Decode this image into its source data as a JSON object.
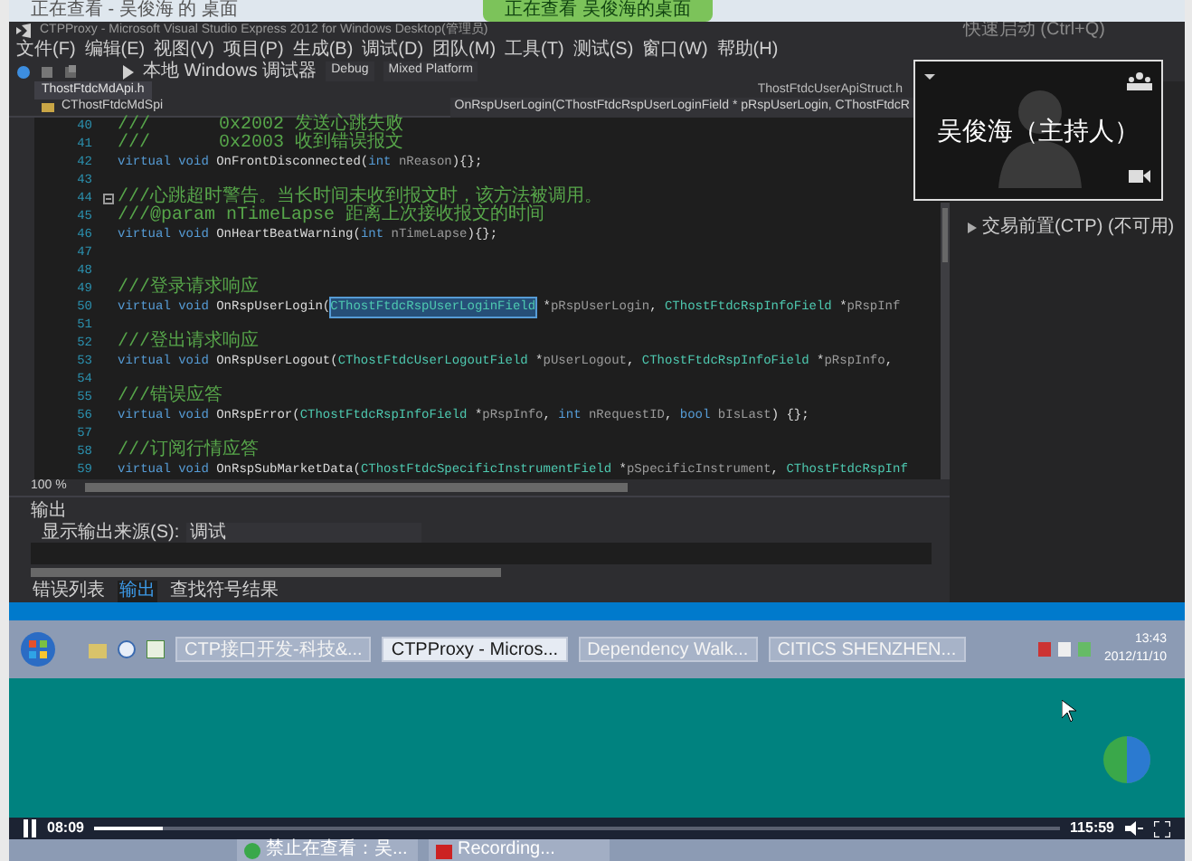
{
  "viewer_bar": {
    "title": "正在查看 - 吴俊海 的 桌面",
    "banner": "正在查看 吴俊海的桌面"
  },
  "vs": {
    "title": "CTPProxy - Microsoft Visual Studio Express 2012 for Windows Desktop(管理员)",
    "quick_launch": "快速启动 (Ctrl+Q)",
    "menu": [
      "文件(F)",
      "编辑(E)",
      "视图(V)",
      "项目(P)",
      "生成(B)",
      "调试(D)",
      "团队(M)",
      "工具(T)",
      "测试(S)",
      "窗口(W)",
      "帮助(H)"
    ],
    "toolbar": {
      "debugger": "本地 Windows 调试器",
      "config": "Debug",
      "platform": "Mixed Platform"
    },
    "tabs": [
      {
        "label": "ThostFtdcMdApi.h",
        "selected": true
      },
      {
        "label": "ThostFtdcUserApiStruct.h",
        "selected": false
      }
    ],
    "nav": {
      "scope": "CThostFtdcMdSpi",
      "member": "OnRspUserLogin(CThostFtdcRspUserLoginField * pRspUserLogin, CThostFtdcR"
    },
    "code_lines": [
      {
        "number": "40",
        "segments": [
          {
            "t": "///",
            "kind": "comment"
          },
          {
            "t": "0x2002 发送心跳失败",
            "kind": "comment"
          }
        ]
      },
      {
        "number": "41",
        "segments": [
          {
            "t": "///",
            "kind": "comment"
          },
          {
            "t": "0x2003 收到错误报文",
            "kind": "comment"
          }
        ]
      },
      {
        "number": "42",
        "segments": [
          {
            "t": "virtual void ",
            "kind": "kw"
          },
          {
            "t": "OnFrontDisconnected(",
            "kind": "plain"
          },
          {
            "t": "int ",
            "kind": "kw"
          },
          {
            "t": "nReason",
            "kind": "param"
          },
          {
            "t": "){};",
            "kind": "plain"
          }
        ]
      },
      {
        "number": "43"
      },
      {
        "number": "44",
        "fold": true,
        "segments": [
          {
            "t": "///心跳超时警告。当长时间未收到报文时，该方法被调用。",
            "kind": "comment"
          }
        ]
      },
      {
        "number": "45",
        "segments": [
          {
            "t": "///@param nTimeLapse 距离上次接收报文的时间",
            "kind": "comment"
          }
        ]
      },
      {
        "number": "46",
        "segments": [
          {
            "t": "virtual void ",
            "kind": "kw"
          },
          {
            "t": "OnHeartBeatWarning(",
            "kind": "plain"
          },
          {
            "t": "int ",
            "kind": "kw"
          },
          {
            "t": "nTimeLapse",
            "kind": "param"
          },
          {
            "t": "){};",
            "kind": "plain"
          }
        ]
      },
      {
        "number": "47"
      },
      {
        "number": "48"
      },
      {
        "number": "49",
        "segments": [
          {
            "t": "///登录请求响应",
            "kind": "comment"
          }
        ]
      },
      {
        "number": "50",
        "segments": [
          {
            "t": "virtual void ",
            "kind": "kw"
          },
          {
            "t": "OnRspUserLogin(",
            "kind": "plain"
          },
          {
            "t": "CThostFtdcRspUserLoginField",
            "kind": "type",
            "selected": true
          },
          {
            "t": " *",
            "kind": "plain"
          },
          {
            "t": "pRspUserLogin",
            "kind": "param"
          },
          {
            "t": ", ",
            "kind": "plain"
          },
          {
            "t": "CThostFtdcRspInfoField",
            "kind": "type"
          },
          {
            "t": " *",
            "kind": "plain"
          },
          {
            "t": "pRspInf",
            "kind": "param"
          }
        ]
      },
      {
        "number": "51"
      },
      {
        "number": "52",
        "segments": [
          {
            "t": "///登出请求响应",
            "kind": "comment"
          }
        ]
      },
      {
        "number": "53",
        "segments": [
          {
            "t": "virtual void ",
            "kind": "kw"
          },
          {
            "t": "OnRspUserLogout(",
            "kind": "plain"
          },
          {
            "t": "CThostFtdcUserLogoutField",
            "kind": "type"
          },
          {
            "t": " *",
            "kind": "plain"
          },
          {
            "t": "pUserLogout",
            "kind": "param"
          },
          {
            "t": ", ",
            "kind": "plain"
          },
          {
            "t": "CThostFtdcRspInfoField",
            "kind": "type"
          },
          {
            "t": " *",
            "kind": "plain"
          },
          {
            "t": "pRspInfo",
            "kind": "param"
          },
          {
            "t": ",",
            "kind": "plain"
          }
        ]
      },
      {
        "number": "54"
      },
      {
        "number": "55",
        "segments": [
          {
            "t": "///错误应答",
            "kind": "comment"
          }
        ]
      },
      {
        "number": "56",
        "segments": [
          {
            "t": "virtual void ",
            "kind": "kw"
          },
          {
            "t": "OnRspError(",
            "kind": "plain"
          },
          {
            "t": "CThostFtdcRspInfoField",
            "kind": "type"
          },
          {
            "t": " *",
            "kind": "plain"
          },
          {
            "t": "pRspInfo",
            "kind": "param"
          },
          {
            "t": ", ",
            "kind": "plain"
          },
          {
            "t": "int ",
            "kind": "kw"
          },
          {
            "t": "nRequestID",
            "kind": "param"
          },
          {
            "t": ", ",
            "kind": "plain"
          },
          {
            "t": "bool ",
            "kind": "kw"
          },
          {
            "t": "bIsLast",
            "kind": "param"
          },
          {
            "t": ") {};",
            "kind": "plain"
          }
        ]
      },
      {
        "number": "57"
      },
      {
        "number": "58",
        "segments": [
          {
            "t": "///订阅行情应答",
            "kind": "comment"
          }
        ]
      },
      {
        "number": "59",
        "segments": [
          {
            "t": "virtual void ",
            "kind": "kw"
          },
          {
            "t": "OnRspSubMarketData(",
            "kind": "plain"
          },
          {
            "t": "CThostFtdcSpecificInstrumentField",
            "kind": "type"
          },
          {
            "t": " *",
            "kind": "plain"
          },
          {
            "t": "pSpecificInstrument",
            "kind": "param"
          },
          {
            "t": ", ",
            "kind": "plain"
          },
          {
            "t": "CThostFtdcRspInf",
            "kind": "type"
          }
        ]
      }
    ],
    "zoom": "100 %",
    "solution_item": "交易前置(CTP) (不可用)",
    "output": {
      "title": "输出",
      "source_label": "显示输出来源(S):",
      "source": "调试"
    },
    "bottom_tabs": [
      {
        "label": "错误列表",
        "selected": false
      },
      {
        "label": "输出",
        "selected": true
      },
      {
        "label": "查找符号结果",
        "selected": false
      }
    ]
  },
  "video_overlay": {
    "name": "吴俊海（主持人）"
  },
  "taskbar": {
    "tasks": [
      {
        "label": "CTP接口开发-科技&...",
        "selected": false
      },
      {
        "label": "CTPProxy - Micros...",
        "selected": true
      },
      {
        "label": "Dependency Walk...",
        "selected": false
      },
      {
        "label": "CITICS SHENZHEN...",
        "selected": false
      }
    ],
    "time": "13:43",
    "date": "2012/11/10"
  },
  "player": {
    "playing": true,
    "elapsed": "08:09",
    "total": "115:59",
    "level": 0.07
  },
  "host_taskbar": {
    "tasks": [
      {
        "label": "禁止在查看：吴...",
        "kind": "globe"
      },
      {
        "label": "Recording...",
        "kind": "record"
      }
    ]
  }
}
